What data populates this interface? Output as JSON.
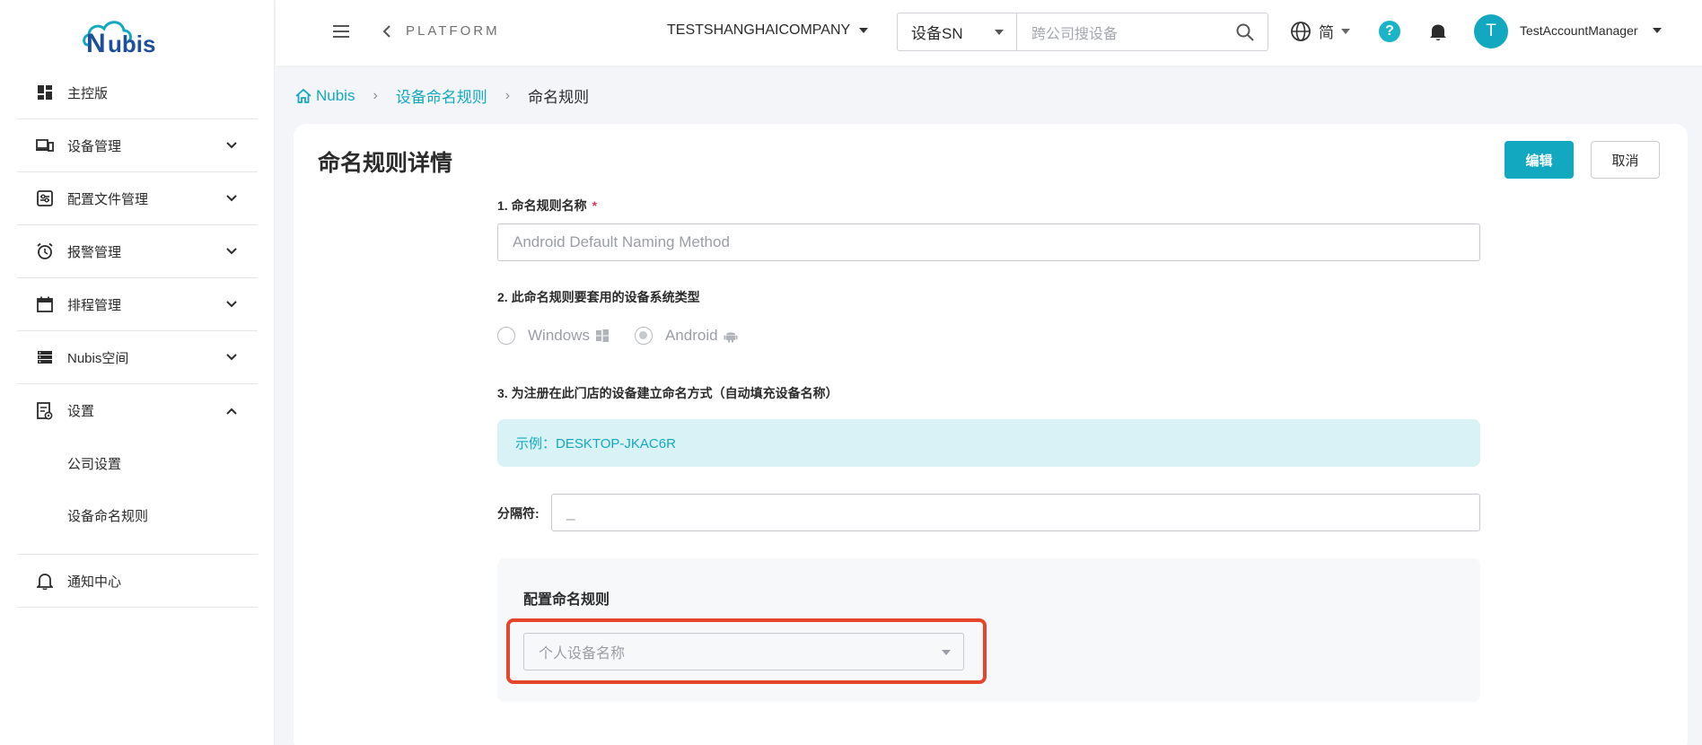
{
  "logo": {
    "text": "Nubis",
    "accent": "#1f4e9b",
    "cloud": "#12a9c0"
  },
  "sidebar": {
    "items": [
      {
        "label": "主控版",
        "icon": "dashboard-icon",
        "expandable": false
      },
      {
        "label": "设备管理",
        "icon": "devices-icon",
        "expandable": true
      },
      {
        "label": "配置文件管理",
        "icon": "config-file-icon",
        "expandable": true
      },
      {
        "label": "报警管理",
        "icon": "alarm-clock-icon",
        "expandable": true
      },
      {
        "label": "排程管理",
        "icon": "calendar-icon",
        "expandable": true
      },
      {
        "label": "Nubis空间",
        "icon": "storage-icon",
        "expandable": true
      },
      {
        "label": "设置",
        "icon": "settings-doc-icon",
        "expandable": true,
        "expanded": true
      }
    ],
    "sub_items": [
      "公司设置",
      "设备命名规则"
    ],
    "notification": {
      "label": "通知中心",
      "icon": "bell-outline-icon"
    }
  },
  "header": {
    "platform": "PLATFORM",
    "company": "TESTSHANGHAICOMPANY",
    "search_select": "设备SN",
    "search_placeholder": "跨公司搜设备",
    "language": "简",
    "avatar_letter": "T",
    "user_name": "TestAccountManager"
  },
  "breadcrumb": {
    "home": "Nubis",
    "parent": "设备命名规则",
    "current": "命名规则"
  },
  "page": {
    "title": "命名规则详情",
    "edit_button": "编辑",
    "cancel_button": "取消",
    "field1_label": "1. 命名规则名称",
    "field1_required": "*",
    "field1_value": "Android Default Naming Method",
    "field2_label": "2. 此命名规则要套用的设备系统类型",
    "os_options": [
      {
        "label": "Windows",
        "checked": false
      },
      {
        "label": "Android",
        "checked": true
      }
    ],
    "field3_label": "3. 为注册在此门店的设备建立命名方式（自动填充设备名称）",
    "example": "示例：DESKTOP-JKAC6R",
    "separator_label": "分隔符:",
    "separator_value": "_",
    "config_title": "配置命名规则",
    "config_select": "个人设备名称"
  },
  "colors": {
    "accent": "#12a9c0",
    "highlight": "#e5452b",
    "required": "#e5335f"
  }
}
